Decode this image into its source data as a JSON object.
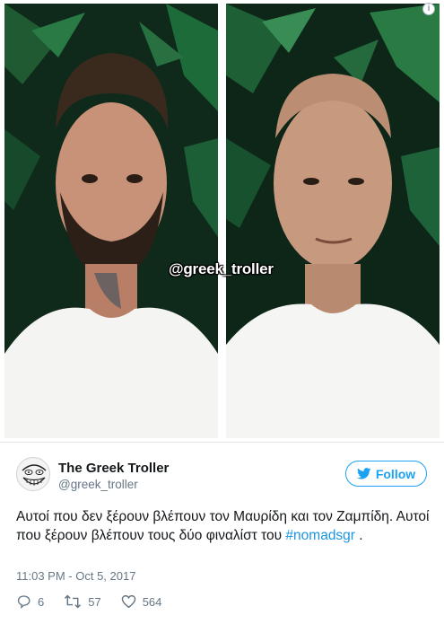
{
  "media": {
    "watermark": "@greek_troller",
    "info_icon": "info-icon"
  },
  "author": {
    "name": "The Greek Troller",
    "handle": "@greek_troller",
    "avatar_icon": "trollface-avatar"
  },
  "follow_button": {
    "label": "Follow",
    "icon": "twitter-bird-icon",
    "color": "#1da1f2"
  },
  "tweet": {
    "text": "Αυτοί που δεν ξέρουν βλέπουν τον Μαυρίδη και τον Ζαμπίδη. Αυτοί που ξέρουν βλέπουν τους δύο φιναλίστ του ",
    "hashtag": "#nomadsgr",
    "suffix": " .",
    "timestamp": "11:03 PM - Oct 5, 2017"
  },
  "actions": {
    "replies": "6",
    "retweets": "57",
    "likes": "564"
  },
  "colors": {
    "link": "#1b95e0",
    "muted": "#657786"
  }
}
